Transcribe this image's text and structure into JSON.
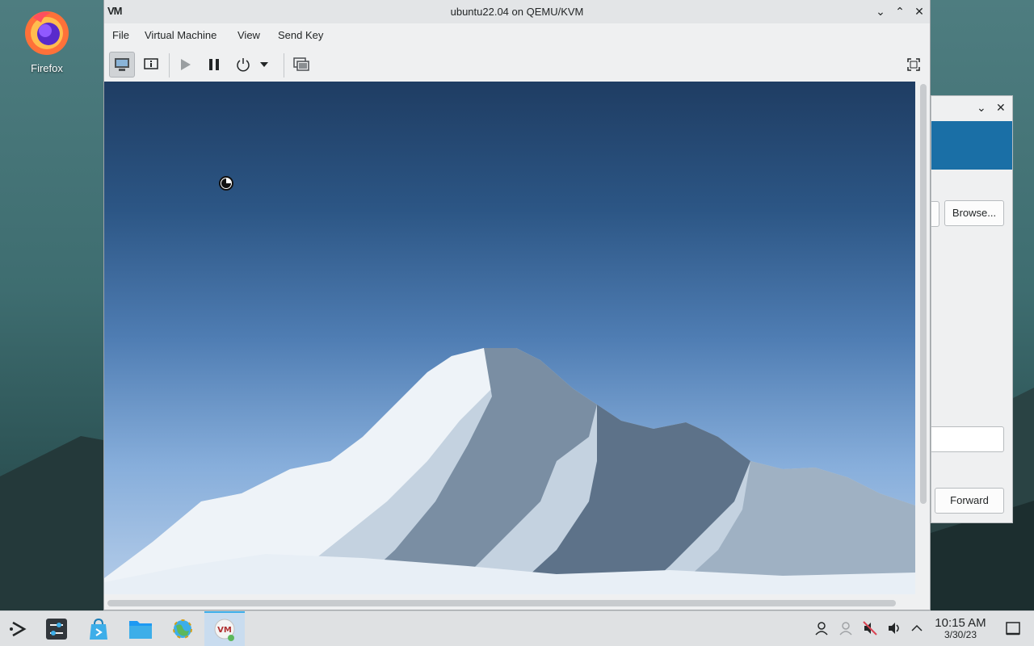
{
  "desktop": {
    "icons": [
      {
        "label": "Firefox",
        "icon": "firefox-icon"
      }
    ]
  },
  "background_dialog": {
    "browse_label": "Browse...",
    "forward_label": "Forward"
  },
  "window": {
    "title": "ubuntu22.04 on QEMU/KVM",
    "logo_text": "VM",
    "menu": [
      "File",
      "Virtual Machine",
      "View",
      "Send Key"
    ],
    "toolbar": [
      "console-icon",
      "info-icon",
      "play-icon",
      "pause-icon",
      "power-icon",
      "dropdown-icon",
      "snapshot-icon",
      "fullscreen-icon"
    ]
  },
  "taskbar": {
    "apps": [
      "launcher-icon",
      "settings-icon",
      "discover-icon",
      "files-icon",
      "browser-icon",
      "virt-manager-icon"
    ],
    "tray": [
      "user-icon",
      "network-icon",
      "muted-icon",
      "volume-icon",
      "expand-tray-icon"
    ],
    "clock_time": "10:15 AM",
    "clock_date": "3/30/23"
  },
  "colors": {
    "accent": "#3daee9",
    "banner": "#1a6fa6"
  }
}
